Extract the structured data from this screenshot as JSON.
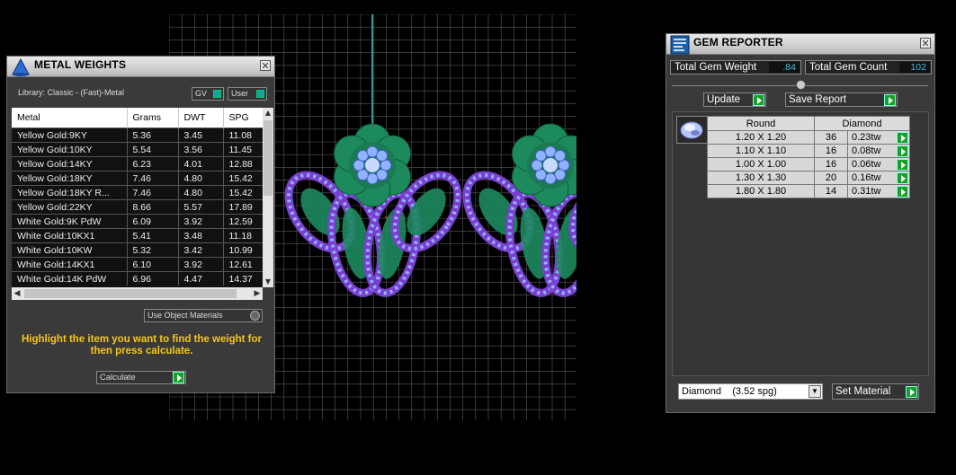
{
  "metal_panel": {
    "title": "METAL WEIGHTS",
    "library": "Library: Classic - (Fast)-Metal",
    "gv_label": "GV",
    "user_label": "User",
    "columns": [
      "Metal",
      "Grams",
      "DWT",
      "SPG"
    ],
    "rows": [
      [
        "Yellow Gold:9KY",
        "5.36",
        "3.45",
        "11.08"
      ],
      [
        "Yellow Gold:10KY",
        "5.54",
        "3.56",
        "11.45"
      ],
      [
        "Yellow Gold:14KY",
        "6.23",
        "4.01",
        "12.88"
      ],
      [
        "Yellow Gold:18KY",
        "7.46",
        "4.80",
        "15.42"
      ],
      [
        "Yellow Gold:18KY R...",
        "7.46",
        "4.80",
        "15.42"
      ],
      [
        "Yellow Gold:22KY",
        "8.66",
        "5.57",
        "17.89"
      ],
      [
        "White Gold:9K PdW",
        "6.09",
        "3.92",
        "12.59"
      ],
      [
        "White Gold:10KX1",
        "5.41",
        "3.48",
        "11.18"
      ],
      [
        "White Gold:10KW",
        "5.32",
        "3.42",
        "10.99"
      ],
      [
        "White Gold:14KX1",
        "6.10",
        "3.92",
        "12.61"
      ],
      [
        "White Gold:14K PdW",
        "6.96",
        "4.47",
        "14.37"
      ]
    ],
    "use_object_materials": "Use Object Materials",
    "hint": "Highlight the item you want to find the weight for then press calculate.",
    "calculate_label": "Calculate"
  },
  "gem_panel": {
    "title": "GEM REPORTER",
    "total_weight_label": "Total Gem Weight",
    "total_weight_value": ".84",
    "total_count_label": "Total Gem Count",
    "total_count_value": "102",
    "update_label": "Update",
    "save_report_label": "Save Report",
    "shape_header": "Round",
    "material_header": "Diamond",
    "rows": [
      [
        "1.20 X 1.20",
        "36",
        "0.23tw"
      ],
      [
        "1.10 X 1.10",
        "16",
        "0.08tw"
      ],
      [
        "1.00 X 1.00",
        "16",
        "0.06tw"
      ],
      [
        "1.30 X 1.30",
        "20",
        "0.16tw"
      ],
      [
        "1.80 X 1.80",
        "14",
        "0.31tw"
      ]
    ],
    "material_select": "Diamond    (3.52 spg)",
    "set_material_label": "Set Material"
  },
  "colors": {
    "background": "#000000",
    "grid": "#5a5a5a",
    "metal_green": "#1d8a5e",
    "gem_blue": "#8fb4ff",
    "gem_purple": "#7a3fd0",
    "hint_yellow": "#f5c518",
    "value_cyan": "#44bbdd"
  }
}
